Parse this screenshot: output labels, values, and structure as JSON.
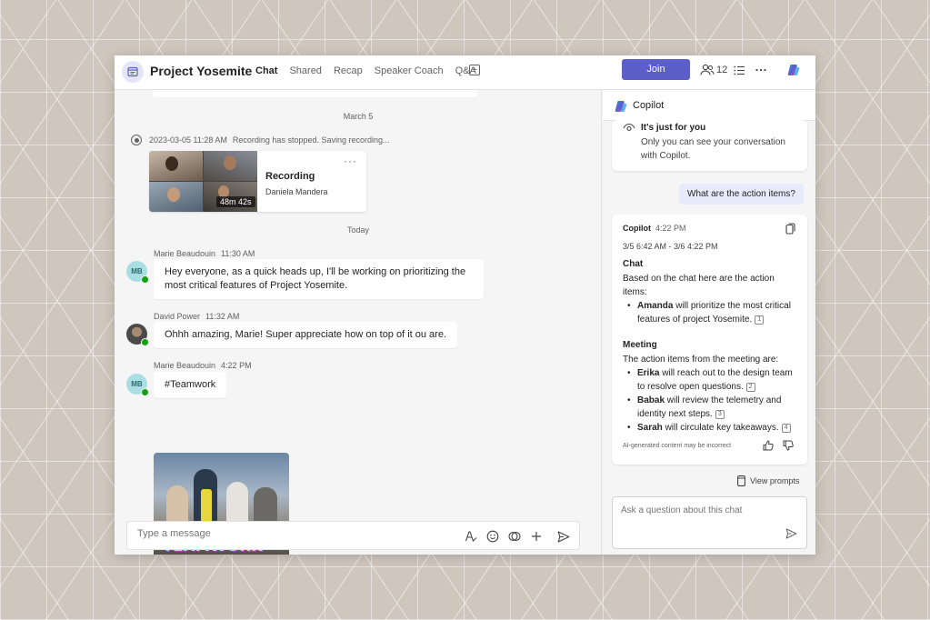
{
  "header": {
    "title": "Project Yosemite",
    "tabs": [
      "Chat",
      "Shared",
      "Recap",
      "Speaker Coach",
      "Q&A"
    ],
    "join_label": "Join",
    "participants_count": "12"
  },
  "chat": {
    "date_march": "March 5",
    "recording": {
      "timestamp": "2023-03-05 11:28 AM",
      "status": "Recording has stopped. Saving recording...",
      "title": "Recording",
      "owner": "Daniela Mandera",
      "duration": "48m 42s"
    },
    "date_today": "Today",
    "messages": [
      {
        "author": "Marie Beaudouin",
        "time": "11:30 AM",
        "initials": "MB",
        "text": "Hey everyone, as a quick heads up, I'll be working on prioritizing the most critical features of Project Yosemite."
      },
      {
        "author": "David Power",
        "time": "11:32 AM",
        "initials": "",
        "text": "Ohhh amazing, Marie! Super appreciate how on top of it ou are."
      },
      {
        "author": "Marie Beaudouin",
        "time": "4:22 PM",
        "initials": "MB",
        "text": "#Teamwork"
      }
    ],
    "gif_caption": "TEAMWORK",
    "composer_placeholder": "Type a message"
  },
  "copilot": {
    "title": "Copilot",
    "privacy_heading": "It's just for you",
    "privacy_body": "Only you can see your conversation with Copilot.",
    "user_question": "What are the action items?",
    "answer": {
      "from": "Copilot",
      "time": "4:22 PM",
      "range": "3/5 6:42 AM - 3/6 4:22 PM",
      "chat_heading": "Chat",
      "chat_intro": "Based on the chat here are the action items:",
      "chat_items": [
        {
          "name": "Amanda",
          "rest": " will prioritize the most critical features of project Yosemite.",
          "ref": "1"
        }
      ],
      "meeting_heading": "Meeting",
      "meeting_intro": "The action items from the meeting are:",
      "meeting_items": [
        {
          "name": "Erika",
          "rest": " will reach out to the design team to resolve open questions.",
          "ref": "2"
        },
        {
          "name": "Babak",
          "rest": " will review the telemetry and identity next steps.",
          "ref": "3"
        },
        {
          "name": "Sarah",
          "rest": " will circulate key takeaways.",
          "ref": "4"
        }
      ],
      "disclaimer": "AI-generated content may be incorrect"
    },
    "view_prompts": "View prompts",
    "ask_placeholder": "Ask a question about this chat"
  },
  "colors": {
    "accent": "#5b5fc7",
    "presence": "#13a10e",
    "user_bubble": "#e8ebfa"
  }
}
